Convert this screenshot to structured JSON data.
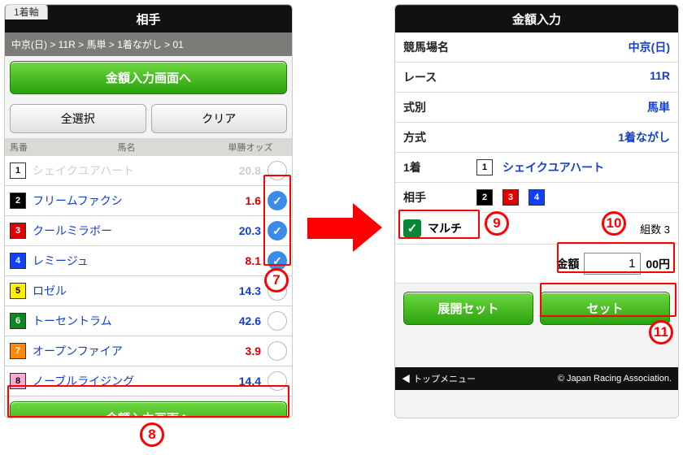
{
  "left": {
    "tab": "1着軸",
    "title": "相手",
    "crumbs": "中京(日) > 11R > 馬単 > 1着ながし > 01",
    "to_amount": "金額入力画面へ",
    "select_all": "全選択",
    "clear": "クリア",
    "hdr_num": "馬番",
    "hdr_name": "馬名",
    "hdr_odds": "単勝オッズ",
    "runners": [
      {
        "no": "1",
        "cls": "w",
        "name": "シェイクユアハート",
        "odds": "20.8",
        "dis": true,
        "sel": false
      },
      {
        "no": "2",
        "cls": "k",
        "name": "フリームファクシ",
        "odds": "1.6",
        "fav": true,
        "sel": true
      },
      {
        "no": "3",
        "cls": "r",
        "name": "クールミラボー",
        "odds": "20.3",
        "sel": true
      },
      {
        "no": "4",
        "cls": "b",
        "name": "レミージュ",
        "odds": "8.1",
        "fav": true,
        "sel": true
      },
      {
        "no": "5",
        "cls": "y",
        "name": "ロゼル",
        "odds": "14.3",
        "sel": false
      },
      {
        "no": "6",
        "cls": "g",
        "name": "トーセントラム",
        "odds": "42.6",
        "sel": false
      },
      {
        "no": "7",
        "cls": "o",
        "name": "オープンファイア",
        "odds": "3.9",
        "fav": true,
        "sel": false
      },
      {
        "no": "8",
        "cls": "p",
        "name": "ノーブルライジング",
        "odds": "14.4",
        "sel": false
      }
    ],
    "bottom_btn": "金額入力画面へ"
  },
  "right": {
    "title": "金額入力",
    "rows": {
      "track_l": "競馬場名",
      "track_v": "中京(日)",
      "race_l": "レース",
      "race_v": "11R",
      "bet_l": "式別",
      "bet_v": "馬単",
      "method_l": "方式",
      "method_v": "1着ながし",
      "first_l": "1着",
      "first_no": "1",
      "first_name": "シェイクユアハート",
      "opp_l": "相手",
      "opp_nos": [
        "2",
        "3",
        "4"
      ],
      "opp_cls": [
        "k",
        "r",
        "b"
      ]
    },
    "multi_label": "マルチ",
    "combo_l": "組数",
    "combo_v": "3",
    "amount_l": "金額",
    "amount_v": "1",
    "amount_unit": "00円",
    "expand": "展開セット",
    "set": "セット",
    "footer_menu": "トップメニュー",
    "footer_c": "© Japan Racing Association."
  },
  "callouts": {
    "n7": "7",
    "n8": "8",
    "n9": "9",
    "n10": "10",
    "n11": "11"
  }
}
